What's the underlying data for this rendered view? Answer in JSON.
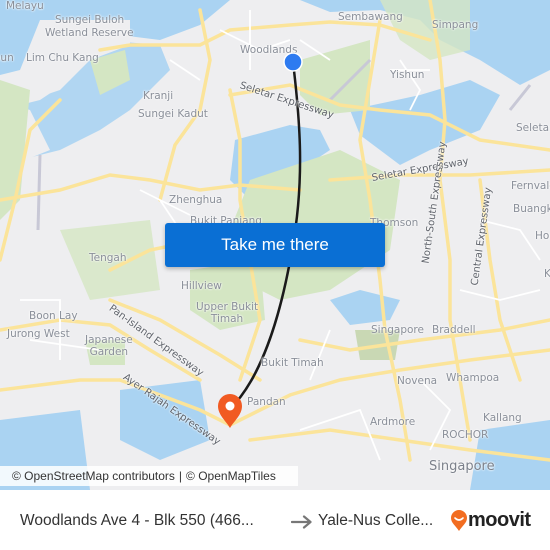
{
  "map": {
    "place_labels": [
      {
        "id": "sungai-melayu",
        "text": "Sungai\nMelayu"
      },
      {
        "id": "sungei-buloh",
        "text": "Sungei Buloh"
      },
      {
        "id": "wetland-reserve",
        "text": "Wetland Reserve"
      },
      {
        "id": "choa-chu-kang",
        "text": "oun"
      },
      {
        "id": "lim-chu-kang",
        "text": "Lim Chu Kang"
      },
      {
        "id": "kranji",
        "text": "Kranji"
      },
      {
        "id": "sungei-kadut",
        "text": "Sungei Kadut"
      },
      {
        "id": "woodlands",
        "text": "Woodlands"
      },
      {
        "id": "sembawang",
        "text": "Sembawang"
      },
      {
        "id": "simpang",
        "text": "Simpang"
      },
      {
        "id": "yishun",
        "text": "Yishun"
      },
      {
        "id": "seletar",
        "text": "Seletar"
      },
      {
        "id": "fernvale",
        "text": "Fernvale"
      },
      {
        "id": "buangkok",
        "text": "Buangkok"
      },
      {
        "id": "hougang",
        "text": "Hougang"
      },
      {
        "id": "zhenghua",
        "text": "Zhenghua"
      },
      {
        "id": "bukit-panjang",
        "text": "Bukit Panjang"
      },
      {
        "id": "thomson",
        "text": "Thomson"
      },
      {
        "id": "tengah",
        "text": "Tengah"
      },
      {
        "id": "hillview",
        "text": "Hillview"
      },
      {
        "id": "upper-bukit-timah",
        "text": "Upper Bukit\nTimah"
      },
      {
        "id": "boon-lay",
        "text": "Boon Lay"
      },
      {
        "id": "jurong-west",
        "text": "Jurong West"
      },
      {
        "id": "japanese-garden",
        "text": "Japanese\nGarden"
      },
      {
        "id": "singapore-area",
        "text": "Singapore"
      },
      {
        "id": "braddell",
        "text": "Braddell"
      },
      {
        "id": "bukit-timah",
        "text": "Bukit Timah"
      },
      {
        "id": "novena",
        "text": "Novena"
      },
      {
        "id": "whampoa",
        "text": "Whampoa"
      },
      {
        "id": "pandan",
        "text": "Pandan"
      },
      {
        "id": "ardmore",
        "text": "Ardmore"
      },
      {
        "id": "kallang",
        "text": "Kallang"
      },
      {
        "id": "rochor",
        "text": "ROCHOR"
      },
      {
        "id": "singapore-city",
        "text": "Singapore"
      },
      {
        "id": "k-label",
        "text": "K"
      }
    ],
    "road_labels": [
      {
        "id": "seletar-expressway-1",
        "text": "Seletar Expressway"
      },
      {
        "id": "seletar-expressway-2",
        "text": "Seletar Expressway"
      },
      {
        "id": "north-south-expressway",
        "text": "North-South Expressway"
      },
      {
        "id": "central-expressway",
        "text": "Central Expressway"
      },
      {
        "id": "pan-island-expressway",
        "text": "Pan-Island Expressway"
      },
      {
        "id": "ayer-rajah-expressway",
        "text": "Ayer Rajah Expressway"
      }
    ],
    "colors": {
      "water": "#aad3f2",
      "land": "#eeeef0",
      "park": "#d4e6c3",
      "road": "#fbe49a",
      "route": "#1a1a1a",
      "origin_marker": "#2e7bf0",
      "destination_marker": "#f15a22"
    },
    "origin_marker_icon": "blue-dot-icon",
    "destination_marker_icon": "map-pin-icon"
  },
  "cta": {
    "label": "Take me there",
    "color": "#0a6fd4"
  },
  "attribution": {
    "osm": "© OpenStreetMap contributors",
    "separator": "|",
    "omt": "© OpenMapTiles"
  },
  "footer": {
    "origin": "Woodlands Ave 4 - Blk 550 (466...",
    "arrow_icon": "arrow-right-icon",
    "destination": "Yale-Nus Colle...",
    "brand": "moovit",
    "brand_color": "#f26d21"
  }
}
